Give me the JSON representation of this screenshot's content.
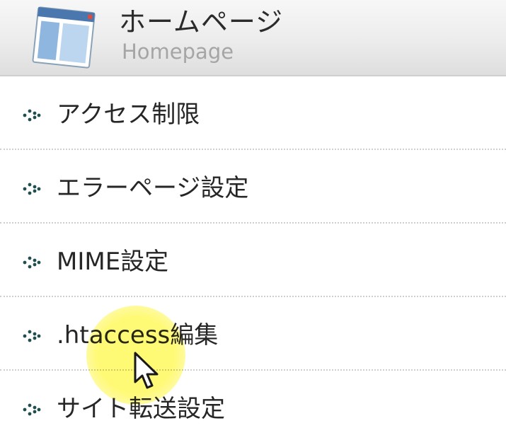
{
  "header": {
    "title": "ホームページ",
    "subtitle": "Homepage",
    "icon": "browser-window-icon"
  },
  "menu": {
    "bullet_icon": "dotted-arrow-bullet-icon",
    "items": [
      {
        "label": "アクセス制限"
      },
      {
        "label": "エラーページ設定"
      },
      {
        "label": "MIME設定"
      },
      {
        "label": ".htaccess編集"
      },
      {
        "label": "サイト転送設定"
      }
    ]
  },
  "cursor": {
    "icon": "mouse-pointer-icon",
    "highlight_color": "#fff85a"
  },
  "colors": {
    "header_bg": "#ececec",
    "title_text": "#2b2b2b",
    "subtitle_text": "#a5a5a5",
    "item_text": "#262626",
    "divider": "#cfcfcf",
    "bullet": "#1f4f4f"
  }
}
